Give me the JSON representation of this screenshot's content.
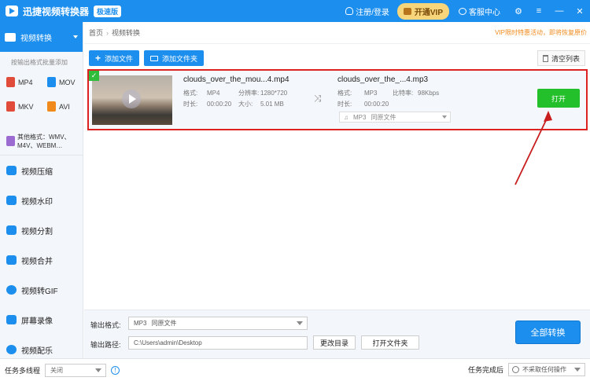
{
  "titlebar": {
    "app_name": "迅捷视频转换器",
    "badge": "极速版",
    "login": "注册/登录",
    "vip": "开通VIP",
    "support": "客服中心",
    "gear": "⚙",
    "menu": "≡",
    "minimize": "—",
    "close": "✕"
  },
  "sidebar": {
    "active": "视频转换",
    "subhead": "按输出格式批量添加",
    "formats": [
      {
        "label": "MP4",
        "color": "#e04b3a"
      },
      {
        "label": "MOV",
        "color": "#1c8fee"
      },
      {
        "label": "MKV",
        "color": "#e04b3a"
      },
      {
        "label": "AVI",
        "color": "#f08a1c"
      }
    ],
    "other_formats": "其他格式：WMV、M4V、WEBM…",
    "items": [
      {
        "label": "视频压缩"
      },
      {
        "label": "视频水印"
      },
      {
        "label": "视频分割"
      },
      {
        "label": "视频合并"
      },
      {
        "label": "视频转GIF"
      },
      {
        "label": "屏幕录像"
      },
      {
        "label": "视频配乐"
      }
    ]
  },
  "breadcrumb": {
    "home": "首页",
    "sep": "›",
    "current": "视频转换"
  },
  "notice": "VIP限时特惠活动，即将恢复原价",
  "toolbar": {
    "add_file": "添加文件",
    "add_folder": "添加文件夹",
    "clear_list": "清空列表"
  },
  "file": {
    "check": "✓",
    "src_name": "clouds_over_the_mou...4.mp4",
    "src_format_label": "格式:",
    "src_format": "MP4",
    "src_res_label": "分辨率:",
    "src_res": "1280*720",
    "src_dur_label": "时长:",
    "src_dur": "00:00:20",
    "src_size_label": "大小:",
    "src_size": "5.01 MB",
    "shuffle": "⤨",
    "out_name": "clouds_over_the_...4.mp3",
    "out_format_label": "格式:",
    "out_format": "MP3",
    "out_bitrate_label": "比特率:",
    "out_bitrate": "98Kbps",
    "out_dur_label": "时长:",
    "out_dur": "00:00:20",
    "out_select_format": "MP3",
    "out_select_quality": "同原文件",
    "music_icon": "♫",
    "open": "打开"
  },
  "bottom": {
    "format_label": "输出格式:",
    "format_value": "MP3",
    "format_quality": "同原文件",
    "path_label": "输出路径:",
    "path_value": "C:\\Users\\admin\\Desktop",
    "change_dir": "更改目录",
    "open_folder": "打开文件夹",
    "convert_all": "全部转换"
  },
  "statusbar": {
    "multithread_label": "任务多线程",
    "multithread_value": "关闭",
    "info": "!",
    "after_label": "任务完成后",
    "after_value": "不采取任何操作"
  }
}
